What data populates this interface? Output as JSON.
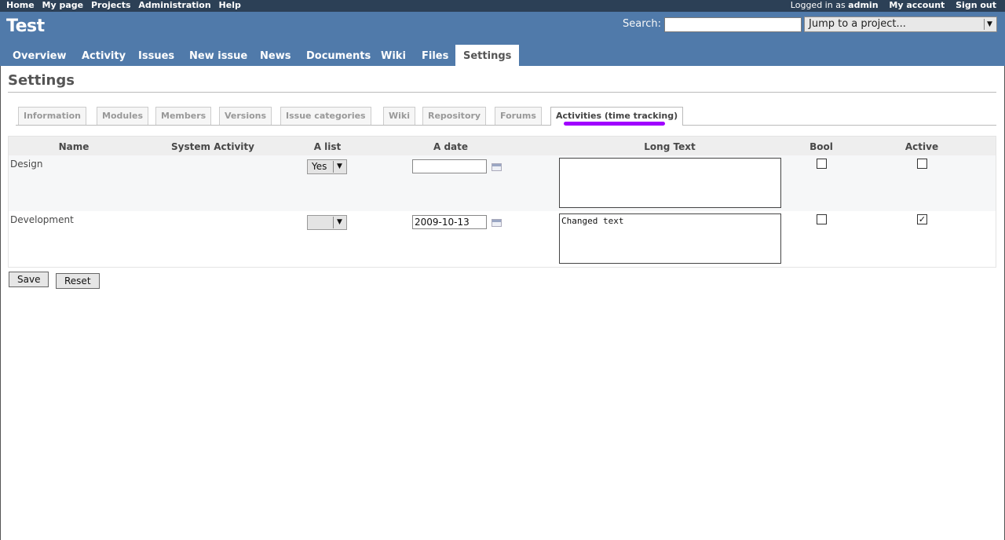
{
  "top_menu": {
    "left": [
      "Home",
      "My page",
      "Projects",
      "Administration",
      "Help"
    ],
    "logged_prefix": "Logged in as",
    "logged_user": "admin",
    "my_account": "My account",
    "sign_out": "Sign out"
  },
  "header": {
    "project_title": "Test",
    "search_label": "Search:",
    "search_value": "",
    "jump_label": "Jump to a project..."
  },
  "main_menu": [
    "Overview",
    "Activity",
    "Issues",
    "New issue",
    "News",
    "Documents",
    "Wiki",
    "Files",
    "Settings"
  ],
  "main_menu_selected": "Settings",
  "page_title": "Settings",
  "tabs": [
    "Information",
    "Modules",
    "Members",
    "Versions",
    "Issue categories",
    "Wiki",
    "Repository",
    "Forums",
    "Activities (time tracking)"
  ],
  "tab_selected": "Activities (time tracking)",
  "table": {
    "headers": [
      "Name",
      "System Activity",
      "A list",
      "A date",
      "Long Text",
      "Bool",
      "Active"
    ],
    "rows": [
      {
        "name": "Design",
        "a_list": "Yes",
        "a_date": "",
        "long_text": "",
        "bool": false,
        "active": false
      },
      {
        "name": "Development",
        "a_list": "",
        "a_date": "2009-10-13",
        "long_text": "Changed text",
        "bool": false,
        "active": true
      }
    ]
  },
  "buttons": {
    "save": "Save",
    "reset": "Reset"
  },
  "colors": {
    "header_bg": "#507aaa",
    "top_menu_bg": "#2c4056",
    "highlight": "#a000ff"
  }
}
